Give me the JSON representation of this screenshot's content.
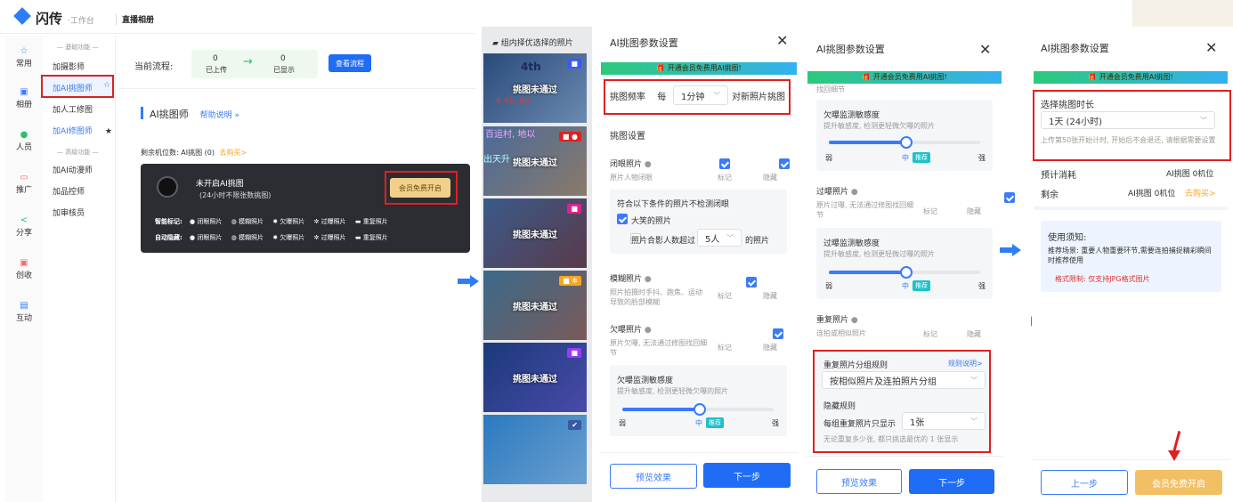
{
  "app": {
    "logo_text": "闪传",
    "logo_sub": "·工作台",
    "page_title": "直播相册"
  },
  "sidebar": [
    {
      "label": "常用",
      "icon": "star-icon"
    },
    {
      "label": "相册",
      "icon": "album-icon"
    },
    {
      "label": "人员",
      "icon": "people-icon"
    },
    {
      "label": "推广",
      "icon": "promote-icon"
    },
    {
      "label": "分享",
      "icon": "share-icon"
    },
    {
      "label": "创收",
      "icon": "revenue-icon"
    },
    {
      "label": "互动",
      "icon": "interact-icon"
    }
  ],
  "submenu": {
    "group1": "— 基础功能 —",
    "items1": [
      "加摄影师",
      "加AI挑图师",
      "加人工修图",
      "加AI修图师"
    ],
    "group2": "— 高级功能 —",
    "items2": [
      "加AI动漫师",
      "加品控师",
      "加审核员"
    ]
  },
  "flow": {
    "label": "当前流程:",
    "uploaded_num": "0",
    "uploaded_label": "已上传",
    "shown_num": "0",
    "shown_label": "已显示",
    "view_button": "查看流程"
  },
  "ai": {
    "title": "AI挑图师",
    "help": "帮助说明 »",
    "remaining": "剩余机位数: AI挑图 (0)",
    "buy": "去购买>",
    "card_title": "未开启AI挑图",
    "card_sub": "(24小时不限张数挑图)",
    "card_button": "会员免费开启",
    "row1_label": "智能标记:",
    "row2_label": "自动隐藏:",
    "tags": [
      "闭眼照片",
      "模糊照片",
      "欠曝照片",
      "过曝照片",
      "重复照片"
    ]
  },
  "photos": {
    "header": "组内择优选择的照片",
    "fail_label": "挑图未通过",
    "texts": [
      "4th",
      "6 4亿 60",
      "百运村, 地以",
      "出天升"
    ]
  },
  "panel1": {
    "title": "AI挑图参数设置",
    "banner": "🎁 开通会员免费用AI挑图!",
    "freq_label": "挑图频率",
    "freq_every": "每",
    "freq_value": "1分钟",
    "freq_suffix": "对新照片挑图",
    "section": "挑图设置",
    "mark": "标记",
    "hide": "隐藏",
    "closed_eye_title": "闭眼照片",
    "closed_eye_desc": "原片人物闭眼",
    "exception_title": "符合以下条件的照片不检测闭眼",
    "exception_1": "大笑的照片",
    "exception_2_pre": "照片合影人数超过",
    "exception_2_val": "5人",
    "exception_2_post": "的照片",
    "blur_title": "模糊照片",
    "blur_desc": "照片拍摄时手抖、跑焦、运动导致的脸部模糊",
    "under_title": "欠曝照片",
    "under_desc": "原片欠曝, 无法通过修图找回细节",
    "sens_title": "欠曝监测敏感度",
    "sens_desc": "提升敏感度, 检测更轻微欠曝的照片",
    "weak": "弱",
    "mid": "中",
    "strong": "强",
    "recommend": "推荐",
    "preview": "预览效果",
    "next": "下一步"
  },
  "panel2": {
    "title": "AI挑图参数设置",
    "banner": "🎁 开通会员免费用AI挑图!",
    "top_cut": "找回细节",
    "under_sens_title": "欠曝监测敏感度",
    "under_sens_desc": "提升敏感度, 检测更轻微欠曝的照片",
    "over_title": "过曝照片",
    "over_desc": "原片过曝, 无法通过修图找回细节",
    "over_sens_title": "过曝监测敏感度",
    "over_sens_desc": "提升敏感度, 检测更轻微过曝的照片",
    "dup_title": "重复照片",
    "dup_desc": "连拍或相似照片",
    "group_rule": "重复照片分组规则",
    "rule_help": "规则说明>",
    "group_value": "按相似照片及连拍照片分组",
    "hide_rule": "隐藏规则",
    "hide_pre": "每组重复照片只显示",
    "hide_val": "1张",
    "hide_note": "无论重复多少张, 都只挑选最优的 1 张显示",
    "mark": "标记",
    "hide": "隐藏",
    "weak": "弱",
    "mid": "中",
    "strong": "强",
    "recommend": "推荐",
    "preview": "预览效果",
    "next": "下一步"
  },
  "panel3": {
    "title": "AI挑图参数设置",
    "banner": "🎁 开通会员免费用AI挑图!",
    "duration_label": "选择挑图时长",
    "duration_value": "1天 (24小时)",
    "duration_note": "上传第50张开始计时, 开始后不会退还, 请根据需要设置",
    "cost_label": "预计消耗",
    "cost_value": "AI挑图 0机位",
    "left_label": "剩余",
    "left_value": "AI挑图 0机位",
    "left_buy": "去购买>",
    "notice_title": "使用须知:",
    "notice_scene": "推荐场景: 重要人物重要环节,需要连拍捕捉精彩瞬间时推荐使用",
    "notice_format": "格式限制: 仅支持JPG格式图片",
    "prev": "上一步",
    "open": "会员免费开启"
  }
}
